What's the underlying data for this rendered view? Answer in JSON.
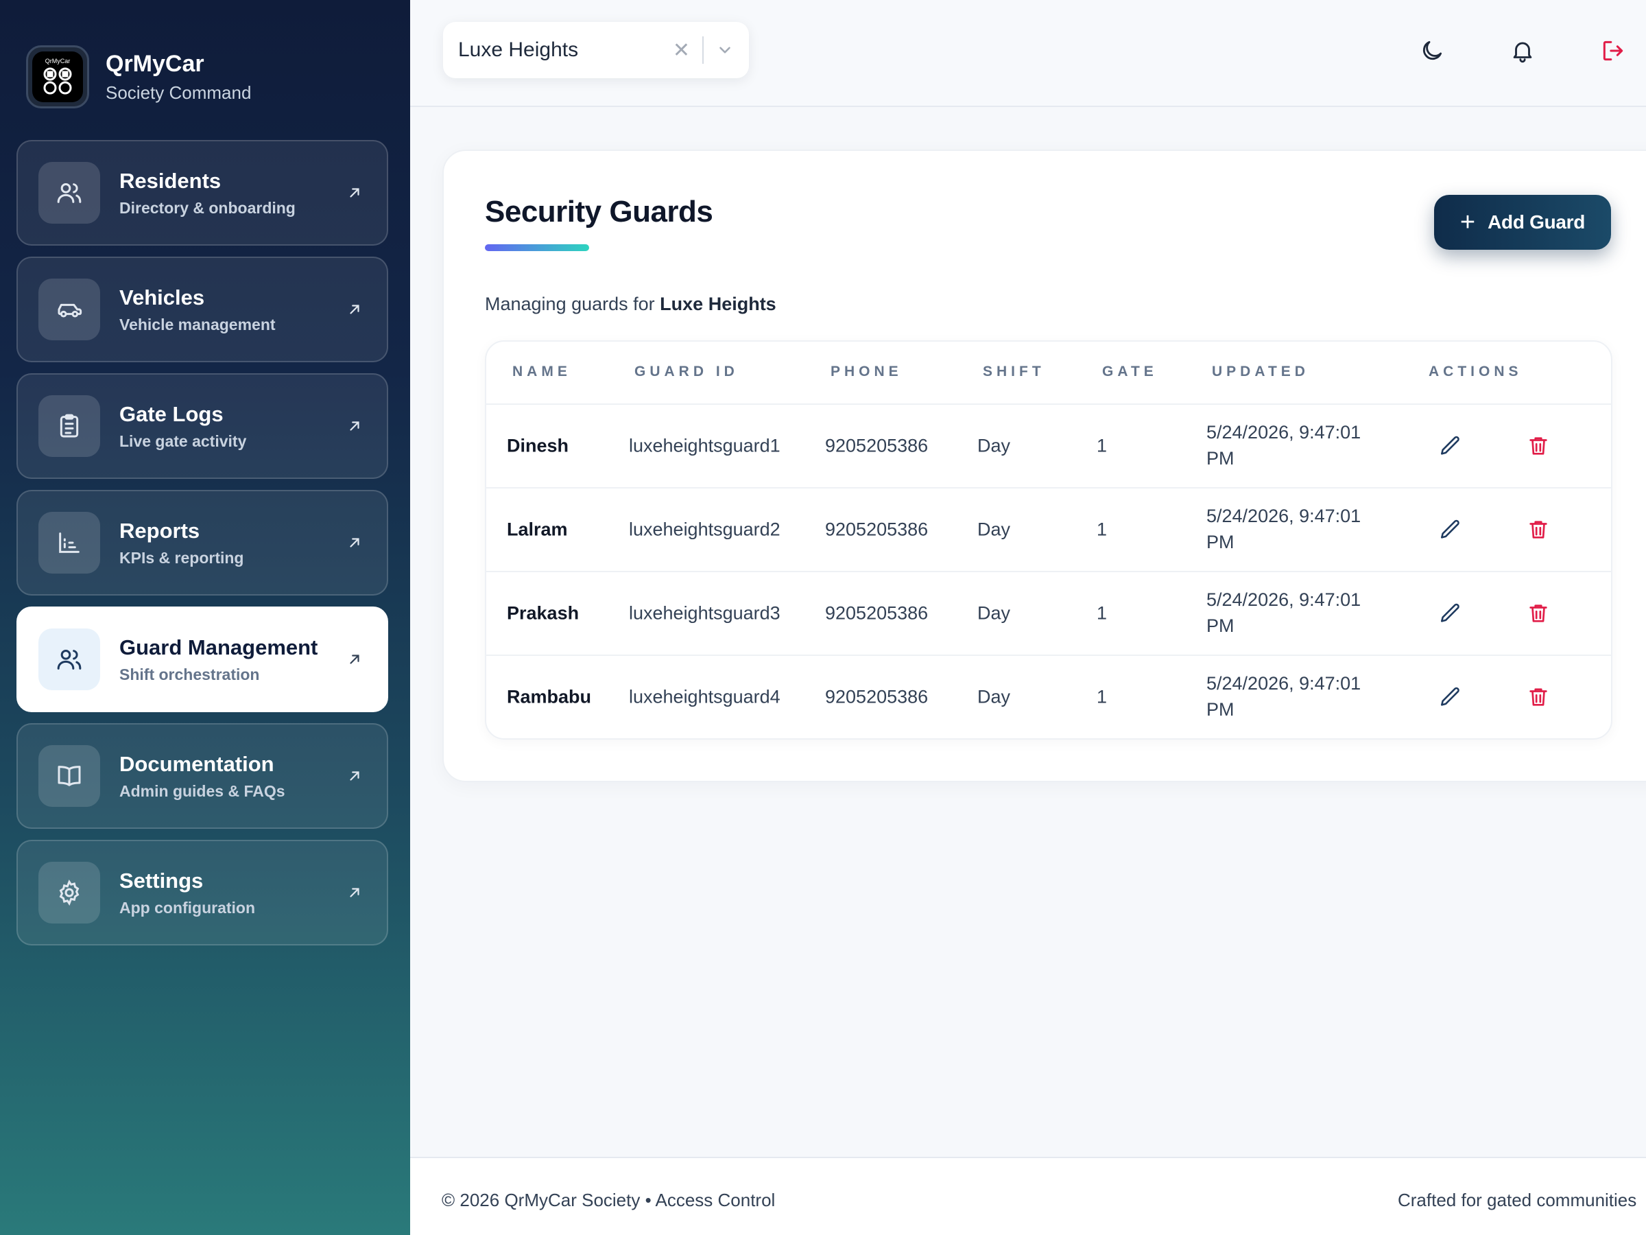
{
  "brand": {
    "logo_text": "QrMyCar",
    "title": "QrMyCar",
    "subtitle": "Society Command"
  },
  "sidebar": {
    "items": [
      {
        "label": "Residents",
        "sub": "Directory & onboarding",
        "icon": "users-icon"
      },
      {
        "label": "Vehicles",
        "sub": "Vehicle management",
        "icon": "car-icon"
      },
      {
        "label": "Gate Logs",
        "sub": "Live gate activity",
        "icon": "clipboard-icon"
      },
      {
        "label": "Reports",
        "sub": "KPIs & reporting",
        "icon": "bar-chart-icon"
      },
      {
        "label": "Guard Management",
        "sub": "Shift orchestration",
        "icon": "users-icon",
        "active": true
      },
      {
        "label": "Documentation",
        "sub": "Admin guides & FAQs",
        "icon": "book-icon"
      },
      {
        "label": "Settings",
        "sub": "App configuration",
        "icon": "gear-icon"
      }
    ]
  },
  "topbar": {
    "society_select": "Luxe Heights",
    "icons": [
      "moon-icon",
      "bell-icon",
      "logout-icon"
    ]
  },
  "main": {
    "title": "Security Guards",
    "add_button": "Add Guard",
    "managing_prefix": "Managing guards for",
    "managing_society": "Luxe Heights",
    "table": {
      "headers": [
        "NAME",
        "GUARD ID",
        "PHONE",
        "SHIFT",
        "GATE",
        "UPDATED",
        "ACTIONS"
      ],
      "rows": [
        {
          "name": "Dinesh",
          "guard_id": "luxeheightsguard1",
          "phone": "9205205386",
          "shift": "Day",
          "gate": "1",
          "updated": "5/24/2026, 9:47:01 PM"
        },
        {
          "name": "Lalram",
          "guard_id": "luxeheightsguard2",
          "phone": "9205205386",
          "shift": "Day",
          "gate": "1",
          "updated": "5/24/2026, 9:47:01 PM"
        },
        {
          "name": "Prakash",
          "guard_id": "luxeheightsguard3",
          "phone": "9205205386",
          "shift": "Day",
          "gate": "1",
          "updated": "5/24/2026, 9:47:01 PM"
        },
        {
          "name": "Rambabu",
          "guard_id": "luxeheightsguard4",
          "phone": "9205205386",
          "shift": "Day",
          "gate": "1",
          "updated": "5/24/2026, 9:47:01 PM"
        }
      ]
    }
  },
  "footer": {
    "left": "© 2026 QrMyCar Society • Access Control",
    "right": "Crafted for gated communities"
  },
  "colors": {
    "accent": "#0f2c4a",
    "danger": "#e11d48",
    "sidebar_top": "#0f1c3a",
    "sidebar_bottom": "#2a7a7a"
  }
}
